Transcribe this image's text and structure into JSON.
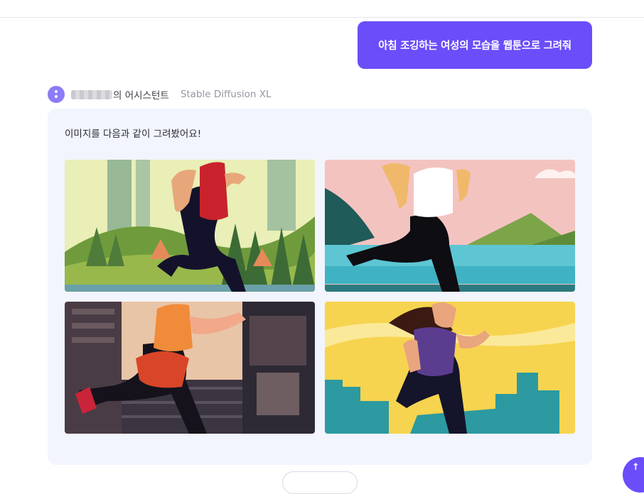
{
  "user_message": {
    "text": "아침 조깅하는 여성의 모습을 웹툰으로 그려줘"
  },
  "assistant": {
    "name_suffix": "의 어시스턴트",
    "model": "Stable Diffusion XL",
    "response_text": "이미지를 다음과 같이 그려봤어요!"
  },
  "images": [
    {
      "name": "jogger-forest-mountains-image"
    },
    {
      "name": "jogger-lake-pink-sky-image"
    },
    {
      "name": "jogger-city-street-image"
    },
    {
      "name": "jogger-yellow-skyline-image"
    }
  ],
  "colors": {
    "accent": "#6b4dfa",
    "card_bg": "#f2f5fd",
    "avatar": "#8b7cf7"
  },
  "icons": {
    "avatar": "assistant-avatar-icon",
    "fab": "scroll-to-bottom-icon"
  }
}
